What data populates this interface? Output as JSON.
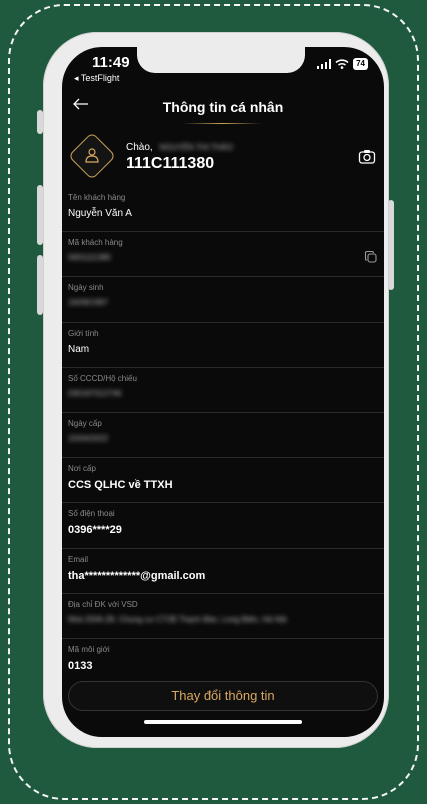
{
  "status_bar": {
    "time": "11:49",
    "back_app": "◂ TestFlight",
    "battery": "74"
  },
  "header": {
    "title": "Thông tin cá nhân"
  },
  "profile": {
    "greeting": "Chào,",
    "name": "NGUYỄN THỊ THẢO",
    "account_id": "111C111380"
  },
  "fields": [
    {
      "label": "Tên khách hàng",
      "value": "Nguyễn Văn A",
      "blurred": false,
      "bold": false
    },
    {
      "label": "Mã khách hàng",
      "value": "0001111380",
      "blurred": true,
      "bold": false,
      "copy": true
    },
    {
      "label": "Ngày sinh",
      "value": "16/09/1997",
      "blurred": true,
      "bold": false
    },
    {
      "label": "Giới tính",
      "value": "Nam",
      "blurred": false,
      "bold": false
    },
    {
      "label": "Số CCCD/Hộ chiếu",
      "value": "030197012746",
      "blurred": true,
      "bold": false
    },
    {
      "label": "Ngày cấp",
      "value": "15/04/2022",
      "blurred": true,
      "bold": false
    },
    {
      "label": "Nơi cấp",
      "value": "CCS QLHC về TTXH",
      "blurred": false,
      "bold": true
    },
    {
      "label": "Số điện thoại",
      "value": "0396****29",
      "blurred": false,
      "bold": true
    },
    {
      "label": "Email",
      "value": "tha*************@gmail.com",
      "blurred": false,
      "bold": true
    },
    {
      "label": "Địa chỉ ĐK với VSD",
      "value": "Nhà 2506-28, Chung cư CT2B Thạch Bàn, Long Biên, Hà Nội",
      "blurred": true,
      "bold": false
    },
    {
      "label": "Mã môi giới",
      "value": "0133",
      "blurred": false,
      "bold": true
    }
  ],
  "actions": {
    "change_info": "Thay đổi thông tin"
  },
  "colors": {
    "background": "#1f5a3f",
    "accent": "#d9a862",
    "screen": "#0a0a0a"
  }
}
